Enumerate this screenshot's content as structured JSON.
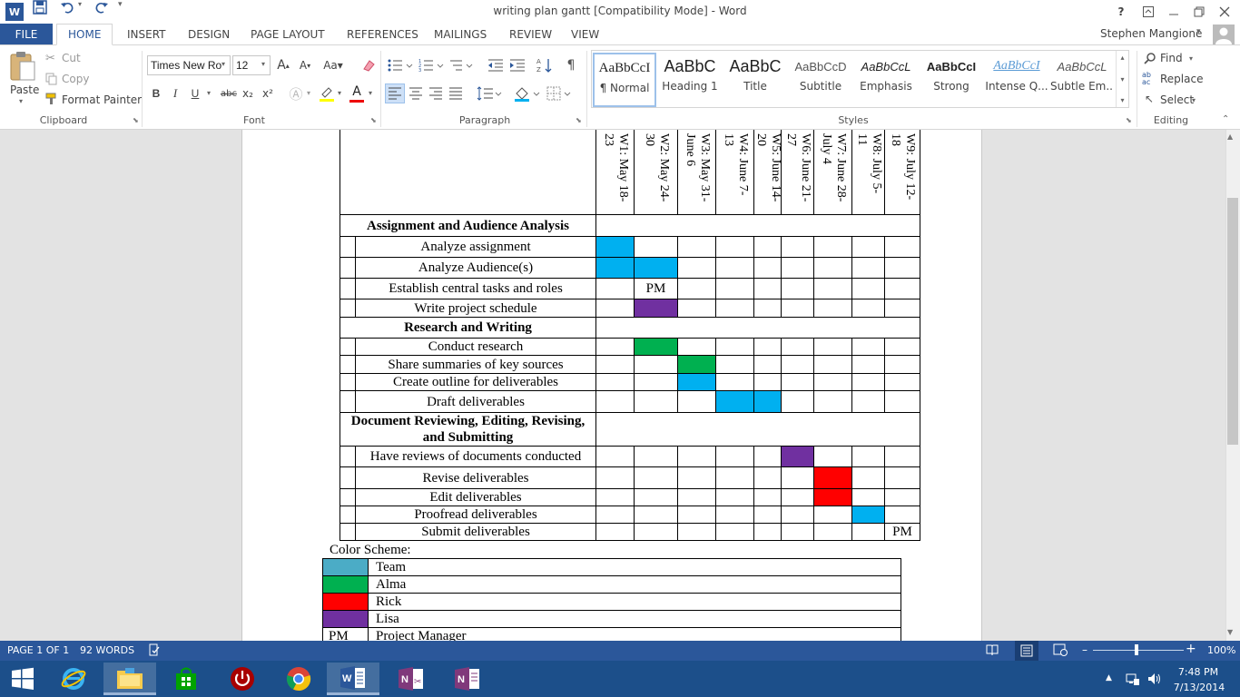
{
  "window": {
    "title": "writing plan gantt [Compatibility Mode] - Word",
    "help": "?",
    "controls": [
      "restore-ribbon",
      "minimize",
      "maximize",
      "close"
    ]
  },
  "quick_access": [
    "word-logo-icon",
    "save-icon",
    "undo-icon",
    "redo-icon",
    "customize-icon"
  ],
  "tabs": {
    "file": "FILE",
    "items": [
      "HOME",
      "INSERT",
      "DESIGN",
      "PAGE LAYOUT",
      "REFERENCES",
      "MAILINGS",
      "REVIEW",
      "VIEW"
    ],
    "active": "HOME"
  },
  "user": "Stephen Mangione",
  "ribbon": {
    "clipboard": {
      "paste": "Paste",
      "cut": "Cut",
      "copy": "Copy",
      "format_painter": "Format Painter",
      "label": "Clipboard"
    },
    "font": {
      "name": "Times New Ro",
      "size": "12",
      "label": "Font",
      "buttons": [
        "B",
        "I",
        "U",
        "abc",
        "x₂",
        "x²",
        "A",
        "A"
      ]
    },
    "paragraph": {
      "label": "Paragraph"
    },
    "styles": {
      "label": "Styles",
      "items": [
        {
          "preview": "AaBbCcI",
          "name": "¶ Normal"
        },
        {
          "preview": "AaBbC",
          "name": "Heading 1"
        },
        {
          "preview": "AaBbC",
          "name": "Title"
        },
        {
          "preview": "AaBbCcD",
          "name": "Subtitle"
        },
        {
          "preview": "AaBbCcL",
          "name": "Emphasis"
        },
        {
          "preview": "AaBbCcI",
          "name": "Strong"
        },
        {
          "preview": "AaBbCcI",
          "name": "Intense Q..."
        },
        {
          "preview": "AaBbCcL",
          "name": "Subtle Em..."
        }
      ]
    },
    "editing": {
      "find": "Find",
      "replace": "Replace",
      "select": "Select",
      "label": "Editing"
    }
  },
  "gantt": {
    "weeks": [
      "W1: May 18-\n23",
      "W2: May 24-\n30",
      "W3: May 31-\nJune 6",
      "W4: June 7-\n13",
      "W5: June 14-\n20",
      "W6: June 21-\n27",
      "W7: June 28-\nJuly 4",
      "W8: July 5-\n11",
      "W9: July 12-\n18"
    ],
    "sections": [
      {
        "title": "Assignment and Audience Analysis",
        "tasks": [
          {
            "name": "Analyze assignment",
            "cells": [
              "team",
              "",
              "",
              "",
              "",
              "",
              "",
              "",
              ""
            ]
          },
          {
            "name": "Analyze Audience(s)",
            "cells": [
              "team",
              "team",
              "",
              "",
              "",
              "",
              "",
              "",
              ""
            ]
          },
          {
            "name": "Establish central tasks and roles",
            "cells": [
              "",
              "PM",
              "",
              "",
              "",
              "",
              "",
              "",
              ""
            ]
          },
          {
            "name": "Write project schedule",
            "cells": [
              "",
              "lisa",
              "",
              "",
              "",
              "",
              "",
              "",
              ""
            ]
          }
        ]
      },
      {
        "title": "Research and Writing",
        "tasks": [
          {
            "name": "Conduct research",
            "cells": [
              "",
              "alma",
              "",
              "",
              "",
              "",
              "",
              "",
              ""
            ]
          },
          {
            "name": "Share summaries of key sources",
            "cells": [
              "",
              "",
              "alma",
              "",
              "",
              "",
              "",
              "",
              ""
            ]
          },
          {
            "name": "Create outline for deliverables",
            "cells": [
              "",
              "",
              "team",
              "",
              "",
              "",
              "",
              "",
              ""
            ]
          },
          {
            "name": "Draft deliverables",
            "cells": [
              "",
              "",
              "",
              "team",
              "team",
              "",
              "",
              "",
              ""
            ]
          }
        ]
      },
      {
        "title": "Document Reviewing, Editing, Revising, and Submitting",
        "tasks": [
          {
            "name": "Have reviews of documents conducted",
            "cells": [
              "",
              "",
              "",
              "",
              "",
              "lisa",
              "",
              "",
              ""
            ]
          },
          {
            "name": "Revise deliverables",
            "cells": [
              "",
              "",
              "",
              "",
              "",
              "",
              "rick",
              "",
              ""
            ]
          },
          {
            "name": "Edit deliverables",
            "cells": [
              "",
              "",
              "",
              "",
              "",
              "",
              "rick",
              "",
              ""
            ]
          },
          {
            "name": "Proofread deliverables",
            "cells": [
              "",
              "",
              "",
              "",
              "",
              "",
              "",
              "team",
              ""
            ]
          },
          {
            "name": "Submit deliverables",
            "cells": [
              "",
              "",
              "",
              "",
              "",
              "",
              "",
              "",
              "PM"
            ]
          }
        ]
      }
    ],
    "colors": {
      "team": "#00b0f0",
      "alma": "#00b050",
      "rick": "#ff0000",
      "lisa": "#7030a0",
      "legend_team": "#4bacc6"
    }
  },
  "color_scheme": {
    "title": "Color Scheme:",
    "rows": [
      {
        "swatch": "team",
        "label": "Team"
      },
      {
        "swatch": "alma",
        "label": "Alma"
      },
      {
        "swatch": "rick",
        "label": "Rick"
      },
      {
        "swatch": "lisa",
        "label": "Lisa"
      },
      {
        "swatch_text": "PM",
        "label": "Project Manager"
      }
    ]
  },
  "status": {
    "page": "PAGE 1 OF 1",
    "words": "92 WORDS",
    "zoom": "100%",
    "zoom_level": 1.0
  },
  "taskbar": {
    "apps": [
      "start-icon",
      "internet-explorer-icon",
      "file-explorer-icon",
      "store-icon",
      "power-app-icon",
      "chrome-icon",
      "word-icon",
      "onenote-clip-icon",
      "onenote-icon"
    ],
    "time": "7:48 PM",
    "date": "7/13/2014"
  }
}
